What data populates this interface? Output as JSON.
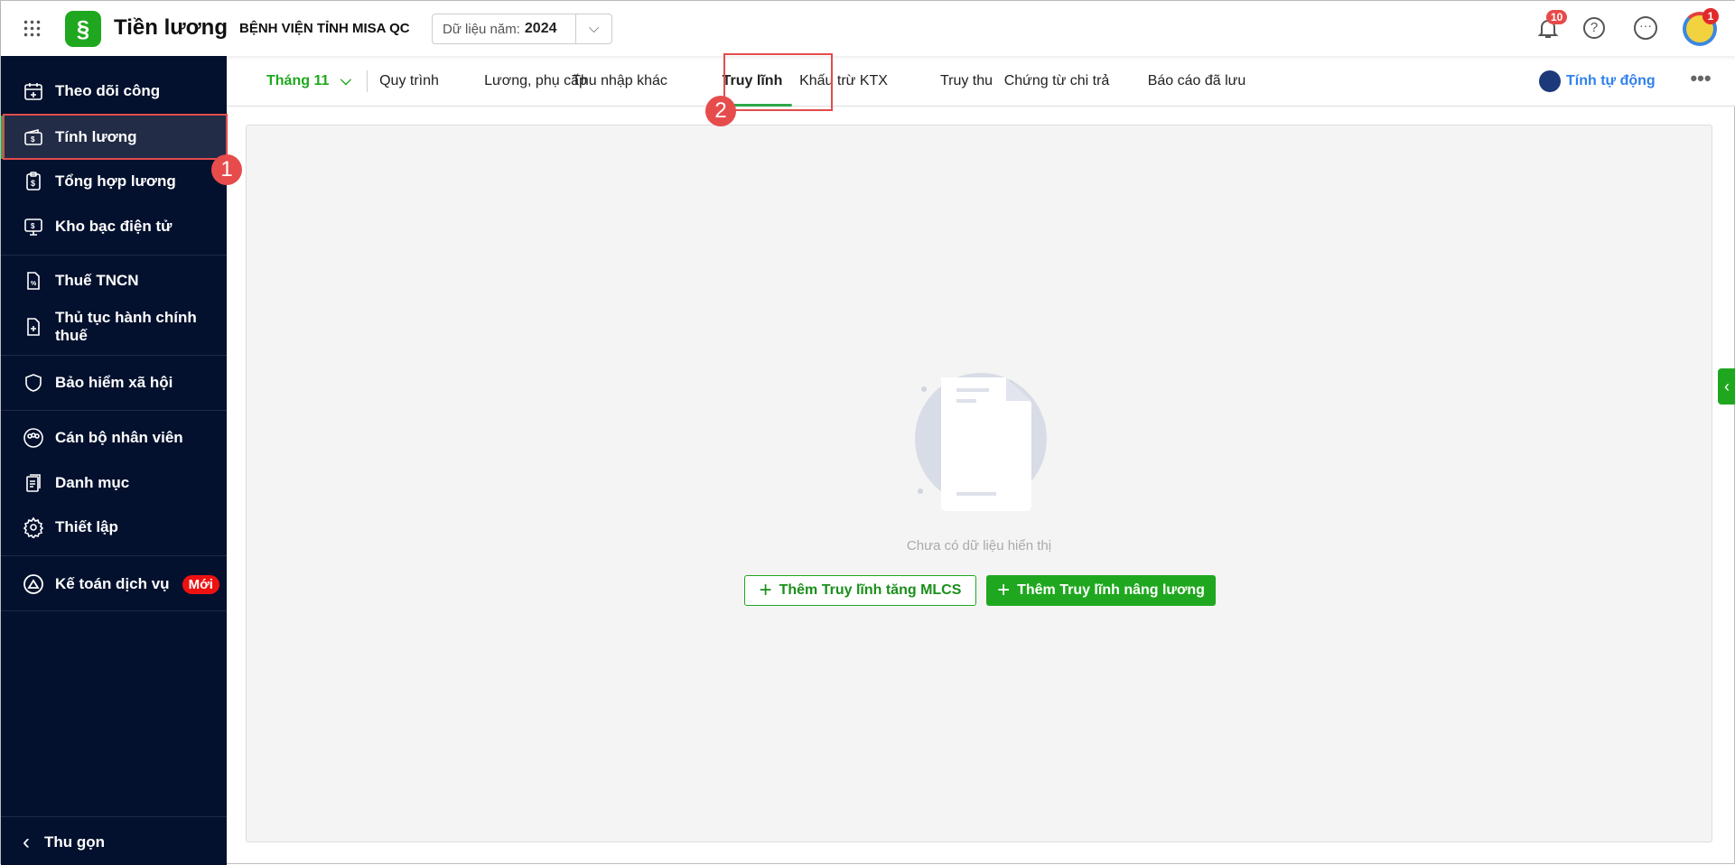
{
  "app": {
    "title": "Tiền lương",
    "org": "BỆNH VIỆN TỈNH MISA QC",
    "year_label": "Dữ liệu năm:",
    "year": "2024",
    "notification_count": "10",
    "avatar_badge": "1"
  },
  "sidebar": {
    "items": [
      {
        "label": "Theo dõi công",
        "icon": "calendar-plus-icon"
      },
      {
        "label": "Tính lương",
        "icon": "wallet-dollar-icon",
        "active": true
      },
      {
        "label": "Tổng hợp lương",
        "icon": "clipboard-dollar-icon"
      },
      {
        "label": "Kho bạc điện tử",
        "icon": "monitor-dollar-icon"
      },
      {
        "label": "Thuế TNCN",
        "icon": "file-percent-icon"
      },
      {
        "label": "Thủ tục hành chính thuế",
        "icon": "file-plus-icon"
      },
      {
        "label": "Bảo hiểm xã hội",
        "icon": "shield-heart-icon"
      },
      {
        "label": "Cán bộ nhân viên",
        "icon": "people-icon"
      },
      {
        "label": "Danh mục",
        "icon": "list-doc-icon"
      },
      {
        "label": "Thiết lập",
        "icon": "gear-icon"
      },
      {
        "label": "Kế toán dịch vụ",
        "icon": "service-logo-icon",
        "badge": "Mới"
      }
    ],
    "collapse_label": "Thu gọn"
  },
  "tabs": {
    "month": "Tháng 11",
    "items": [
      "Quy trình",
      "Lương, phụ cấp",
      "Thu nhập khác",
      "Truy lĩnh",
      "Khấu trừ KTX",
      "Truy thu",
      "Chứng từ chi trả",
      "Báo cáo đã lưu"
    ],
    "active": "Truy lĩnh",
    "auto_label": "Tính tự động"
  },
  "empty": {
    "message": "Chưa có dữ liệu hiển thị",
    "btn_mlcs": "Thêm Truy lĩnh tăng MLCS",
    "btn_raise": "Thêm Truy lĩnh nâng lương"
  },
  "annotations": {
    "step1": "1",
    "step2": "2"
  },
  "colors": {
    "brand_green": "#1fa81f",
    "sidebar_bg": "#03112e",
    "annotation_red": "#e24c4c",
    "link_blue": "#2f80ed"
  }
}
